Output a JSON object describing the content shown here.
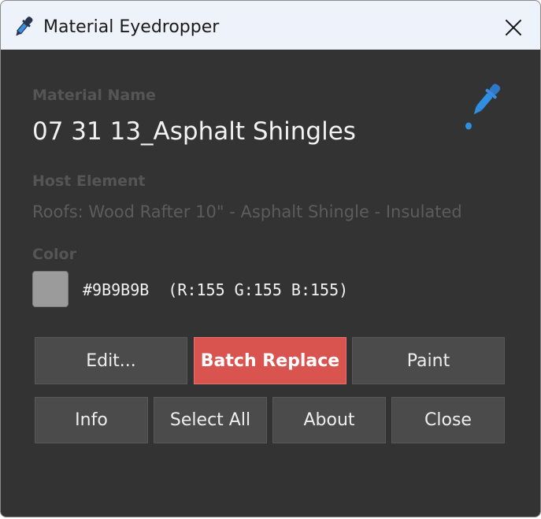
{
  "window": {
    "title": "Material Eyedropper"
  },
  "material": {
    "label": "Material Name",
    "value": "07 31 13_Asphalt Shingles"
  },
  "host": {
    "label": "Host Element",
    "value": "Roofs: Wood Rafter 10\" - Asphalt Shingle - Insulated"
  },
  "color": {
    "label": "Color",
    "hex": "#9B9B9B",
    "rgb_text": "(R:155 G:155 B:155)",
    "swatch_color": "#9b9b9b"
  },
  "buttons": {
    "edit": "Edit...",
    "batch_replace": "Batch Replace",
    "paint": "Paint",
    "info": "Info",
    "select_all": "Select All",
    "about": "About",
    "close": "Close"
  },
  "icons": {
    "title": "eyedropper-icon",
    "close": "close-icon",
    "main": "eyedropper-icon"
  },
  "colors": {
    "accent": "#d9534f",
    "eyedropper_blue": "#2f8fe0"
  }
}
